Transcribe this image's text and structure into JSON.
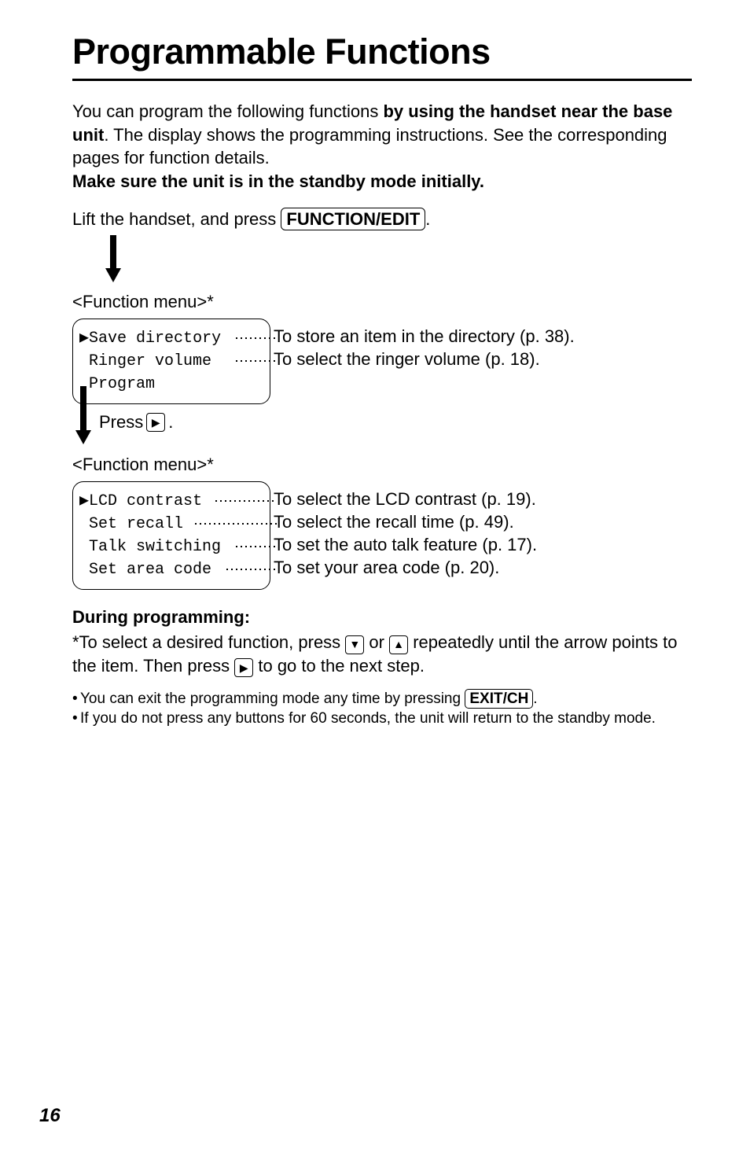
{
  "title": "Programmable Functions",
  "intro": {
    "line1a": "You can program the following functions ",
    "line1b": "by using the handset near the base unit",
    "line1c": ". The display shows the programming instructions. See the corresponding pages for function details.",
    "line2": "Make sure the unit is in the standby mode initially."
  },
  "lift": {
    "pre": "Lift the handset, and press ",
    "btn": "FUNCTION/EDIT",
    "post": "."
  },
  "menu_label": "<Function menu>*",
  "lcd1": {
    "lines": [
      "▶Save directory",
      " Ringer volume",
      " Program"
    ],
    "descs": [
      {
        "dots": 30,
        "text": "To store an item in the directory (p. 38)."
      },
      {
        "dots": 30,
        "text": "To select the ringer volume (p. 18)."
      }
    ]
  },
  "press": {
    "pre": "Press ",
    "post": "."
  },
  "lcd2": {
    "lines": [
      "▶LCD contrast",
      " Set recall",
      " Talk switching",
      " Set area code"
    ],
    "descs": [
      {
        "dots": 48,
        "text": "To select the LCD contrast (p. 19)."
      },
      {
        "dots": 74,
        "text": "To select the recall time (p. 49)."
      },
      {
        "dots": 30,
        "text": "To set the auto talk feature (p. 17)."
      },
      {
        "dots": 38,
        "text": "To set your area code (p. 20)."
      }
    ]
  },
  "during": {
    "head": "During programming:",
    "text1a": "*To select a desired function, press ",
    "text1b": " or ",
    "text1c": " repeatedly until the arrow points to the item. Then press ",
    "text1d": " to go to the next step."
  },
  "bullets": {
    "b1a": "You can exit the programming mode any time by pressing ",
    "b1btn": "EXIT/CH",
    "b1b": ".",
    "b2": "If you do not press any buttons for 60 seconds, the unit will return to the standby mode."
  },
  "page_num": "16",
  "icons": {
    "right": "▶",
    "down": "▼",
    "up": "▲"
  }
}
